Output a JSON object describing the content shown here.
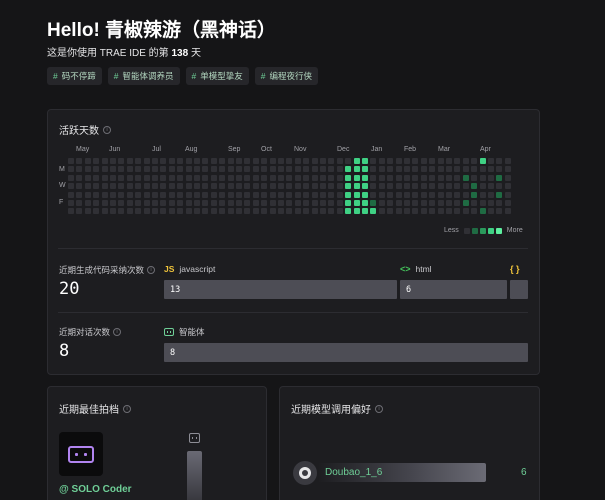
{
  "header": {
    "title": "Hello! 青椒辣游（黑神话）",
    "subtitle_prefix": "这是你使用 TRAE IDE 的第",
    "days_count": "138",
    "subtitle_suffix": "天"
  },
  "tags": [
    {
      "hash": "#",
      "label": "码不停蹄"
    },
    {
      "hash": "#",
      "label": "智能体调养员"
    },
    {
      "hash": "#",
      "label": "单模型挚友"
    },
    {
      "hash": "#",
      "label": "编程夜行侠"
    }
  ],
  "activity": {
    "title": "活跃天数",
    "months": [
      "May",
      "Jun",
      "Jul",
      "Aug",
      "Sep",
      "Oct",
      "Nov",
      "Dec",
      "Jan",
      "Feb",
      "Mar",
      "Apr"
    ],
    "day_labels": [
      "M",
      "W",
      "F"
    ],
    "legend_less": "Less",
    "legend_more": "More",
    "colors": {
      "empty": "#303035",
      "level1": "#1f6b43",
      "level2": "#2a9a5c",
      "level3": "#3fd184",
      "level4": "#5ef0a0"
    },
    "active_cells": [
      {
        "week": 33,
        "day": 1,
        "level": 3
      },
      {
        "week": 33,
        "day": 2,
        "level": 3
      },
      {
        "week": 33,
        "day": 3,
        "level": 3
      },
      {
        "week": 33,
        "day": 4,
        "level": 3
      },
      {
        "week": 33,
        "day": 5,
        "level": 3
      },
      {
        "week": 33,
        "day": 6,
        "level": 3
      },
      {
        "week": 34,
        "day": 0,
        "level": 3
      },
      {
        "week": 34,
        "day": 1,
        "level": 3
      },
      {
        "week": 34,
        "day": 2,
        "level": 3
      },
      {
        "week": 34,
        "day": 3,
        "level": 3
      },
      {
        "week": 34,
        "day": 4,
        "level": 3
      },
      {
        "week": 34,
        "day": 5,
        "level": 3
      },
      {
        "week": 34,
        "day": 6,
        "level": 3
      },
      {
        "week": 35,
        "day": 0,
        "level": 3
      },
      {
        "week": 35,
        "day": 1,
        "level": 3
      },
      {
        "week": 35,
        "day": 2,
        "level": 3
      },
      {
        "week": 35,
        "day": 3,
        "level": 3
      },
      {
        "week": 35,
        "day": 4,
        "level": 3
      },
      {
        "week": 35,
        "day": 5,
        "level": 3
      },
      {
        "week": 35,
        "day": 6,
        "level": 3
      },
      {
        "week": 36,
        "day": 5,
        "level": 1
      },
      {
        "week": 36,
        "day": 6,
        "level": 3
      },
      {
        "week": 47,
        "day": 2,
        "level": 1
      },
      {
        "week": 47,
        "day": 5,
        "level": 1
      },
      {
        "week": 48,
        "day": 3,
        "level": 1
      },
      {
        "week": 48,
        "day": 4,
        "level": 1
      },
      {
        "week": 49,
        "day": 0,
        "level": 3
      },
      {
        "week": 49,
        "day": 6,
        "level": 1
      },
      {
        "week": 51,
        "day": 2,
        "level": 1
      },
      {
        "week": 51,
        "day": 4,
        "level": 1
      }
    ]
  },
  "code_stats": {
    "label": "近期生成代码采纳次数",
    "value": "20",
    "languages": [
      {
        "icon": "JS",
        "name": "javascript",
        "count": "13"
      },
      {
        "icon": "<>",
        "name": "html",
        "count": "6"
      },
      {
        "icon": "{ }",
        "name": "",
        "count": ""
      }
    ]
  },
  "chat_stats": {
    "label": "近期对话次数",
    "value": "8",
    "agent_name": "智能体",
    "agent_count": "8"
  },
  "partner": {
    "title": "近期最佳拍档",
    "name": "@ SOLO Coder",
    "accent": "#b184f0"
  },
  "model_pref": {
    "title": "近期模型调用偏好",
    "model_name": "Doubao_1_6",
    "model_count": "6"
  }
}
